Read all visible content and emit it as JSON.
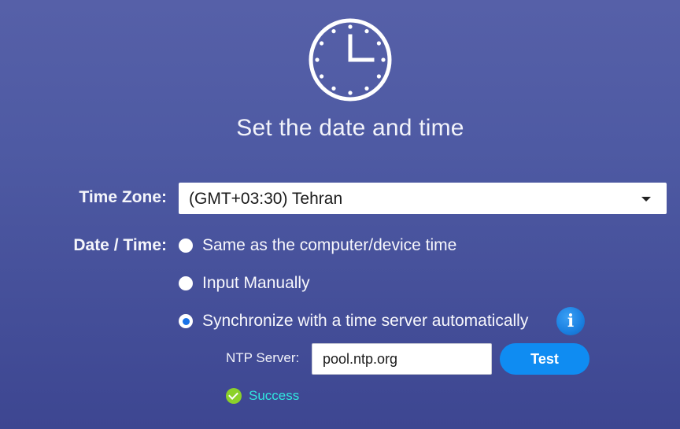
{
  "header": {
    "icon": "clock-icon",
    "title": "Set the date and time"
  },
  "timezone": {
    "label": "Time Zone:",
    "selected": "(GMT+03:30) Tehran"
  },
  "datetime": {
    "label": "Date / Time:",
    "options": [
      {
        "label": "Same as the computer/device time",
        "checked": false
      },
      {
        "label": "Input Manually",
        "checked": false
      },
      {
        "label": "Synchronize with a time server automatically",
        "checked": true
      }
    ],
    "info_icon": "i"
  },
  "ntp": {
    "label": "NTP Server:",
    "value": "pool.ntp.org",
    "test_label": "Test",
    "status": "Success"
  },
  "colors": {
    "background": "#4e5aa3",
    "accent": "#0f8cf2",
    "success_icon": "#8bd12a",
    "success_text": "#31e6df"
  }
}
